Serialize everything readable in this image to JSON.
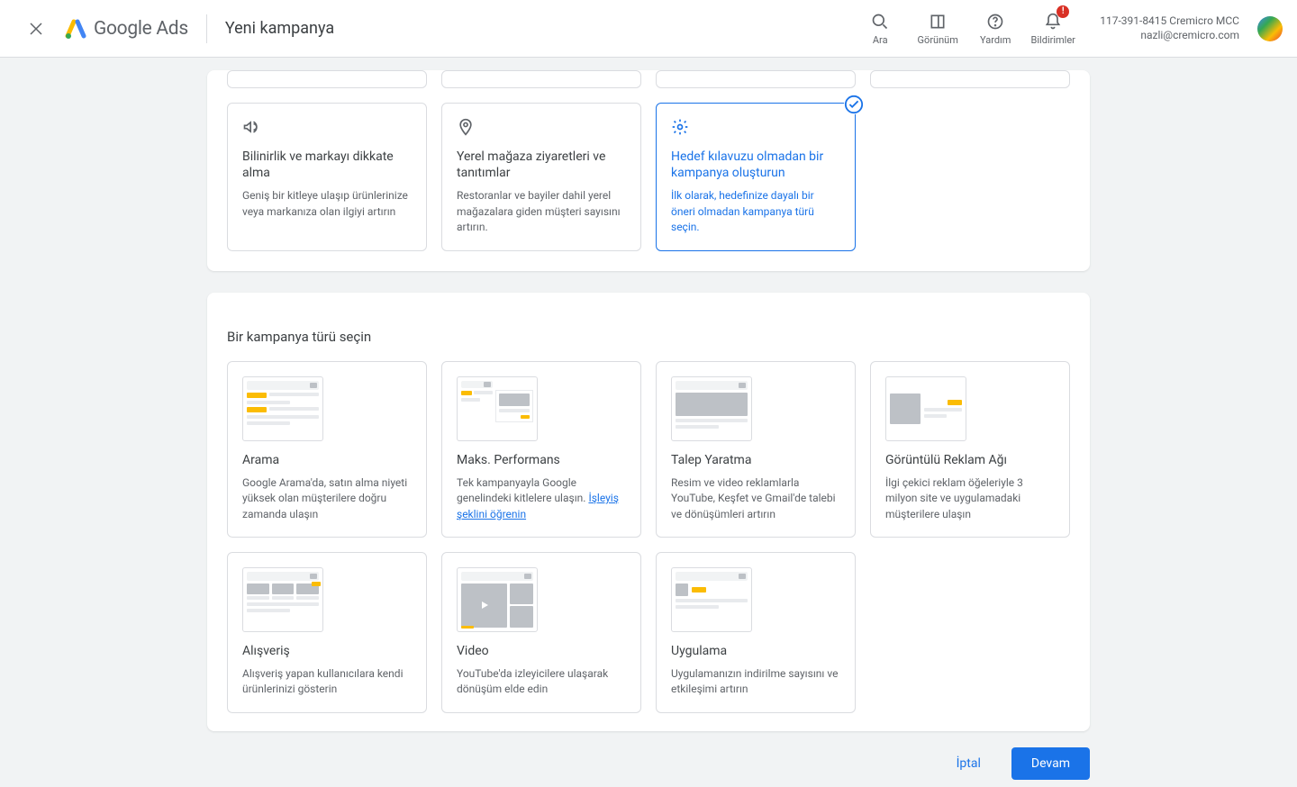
{
  "header": {
    "brand": "Google Ads",
    "title": "Yeni kampanya",
    "actions": {
      "search": "Ara",
      "view": "Görünüm",
      "help": "Yardım",
      "notifications": "Bildirimler",
      "badge": "!"
    },
    "account": {
      "line1": "117-391-8415 Cremicro MCC",
      "line2": "nazli@cremicro.com"
    }
  },
  "goals": {
    "awareness": {
      "title": "Bilinirlik ve markayı dikkate alma",
      "desc": "Geniş bir kitleye ulaşıp ürünlerinize veya markanıza olan ilgiyi artırın"
    },
    "local": {
      "title": "Yerel mağaza ziyaretleri ve tanıtımlar",
      "desc": "Restoranlar ve bayiler dahil yerel mağazalara giden müşteri sayısını artırın."
    },
    "noguide": {
      "title": "Hedef kılavuzu olmadan bir kampanya oluşturun",
      "desc": "İlk olarak, hedefinize dayalı bir öneri olmadan kampanya türü seçin."
    }
  },
  "types": {
    "section_title": "Bir kampanya türü seçin",
    "search": {
      "title": "Arama",
      "desc": "Google Arama'da, satın alma niyeti yüksek olan müşterilere doğru zamanda ulaşın"
    },
    "pmax": {
      "title": "Maks. Performans",
      "desc_prefix": "Tek kampanyayla Google genelindeki kitlelere ulaşın. ",
      "link": "İşleyiş şeklini öğrenin"
    },
    "demand": {
      "title": "Talep Yaratma",
      "desc": "Resim ve video reklamlarla YouTube, Keşfet ve Gmail'de talebi ve dönüşümleri artırın"
    },
    "display": {
      "title": "Görüntülü Reklam Ağı",
      "desc": "İlgi çekici reklam öğeleriyle 3 milyon site ve uygulamadaki müşterilere ulaşın"
    },
    "shopping": {
      "title": "Alışveriş",
      "desc": "Alışveriş yapan kullanıcılara kendi ürünlerinizi gösterin"
    },
    "video": {
      "title": "Video",
      "desc": "YouTube'da izleyicilere ulaşarak dönüşüm elde edin"
    },
    "app": {
      "title": "Uygulama",
      "desc": "Uygulamanızın indirilme sayısını ve etkileşimi artırın"
    }
  },
  "footer": {
    "cancel": "İptal",
    "continue": "Devam"
  }
}
